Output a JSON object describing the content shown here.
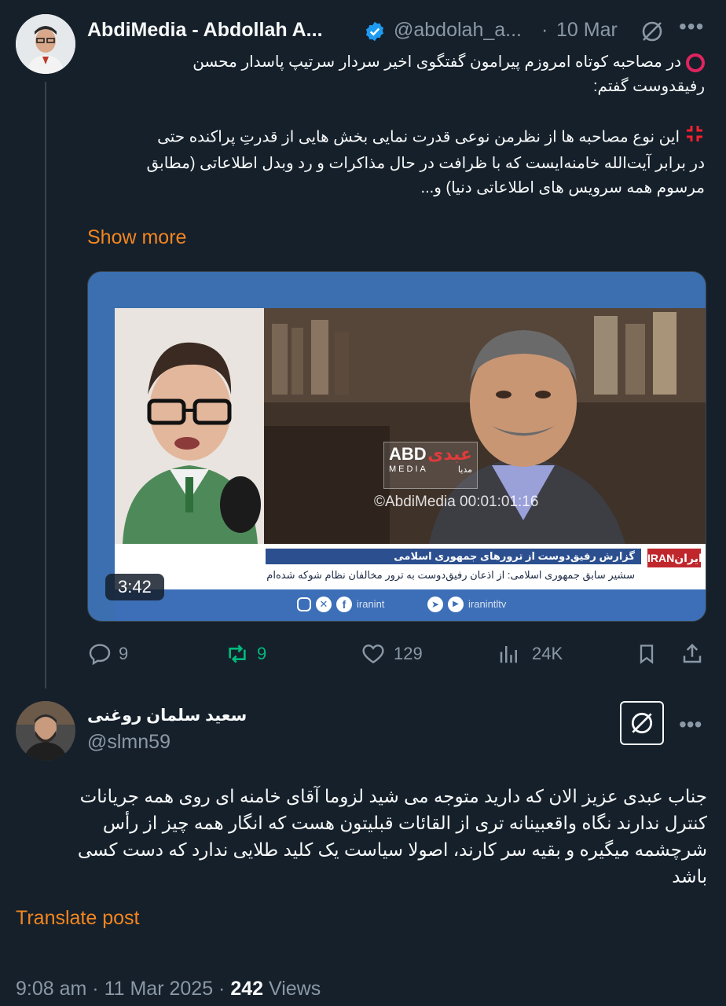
{
  "tweet": {
    "author_name": "AbdiMedia - Abdollah A...",
    "handle": "@abdolah_a...",
    "date": "10 Mar",
    "text_line1": "در مصاحبه کوتاه امروزم پیرامون گفتگوی اخیر سردار سرتیپ پاسدار محسن",
    "text_line2": "رفیقدوست گفتم:",
    "text_line3": "این نوع مصاحبه ها از نظرمن نوعی قدرت نمایی بخش هایی از قدرتِ پراکنده حتی",
    "text_line4": "در برابر آیت‌الله خامنه‌ایست که با ظرافت در حال مذاکرات و رد وبدل اطلاعاتی (مطابق",
    "text_line5": "مرسوم همه سرویس های اطلاعاتی دنیا) و...",
    "show_more": "Show more",
    "media": {
      "duration": "3:42",
      "watermark": "©AbdiMedia 00:01:01:16",
      "logo_top": "ABD",
      "logo_top_fa": "عبدی",
      "logo_bottom": "MEDIA",
      "logo_bottom_fa": "مدیا",
      "banner_line1": "گزارش رفیق‌دوست از ترورهای جمهوری اسلامی",
      "banner_line2": "سشیر سابق جمهوری اسلامی: از اذعان رفیق‌دوست به ترور مخالفان نظام شوکه شده‌ام",
      "channel": "IRANایران",
      "social1": "iranint",
      "social2": "iranintltv"
    },
    "replies": "9",
    "reposts": "9",
    "likes": "129",
    "views": "24K"
  },
  "reply": {
    "author_name": "سعید سلمان روغنی",
    "handle": "@slmn59",
    "text_line1": "جناب عبدی عزیز الان که دارید متوجه می شید لزوما آقای خامنه ای روی همه جریانات",
    "text_line2": "کنترل ندارند نگاه واقعبینانه تری از القائات قبلیتون هست که انگار همه چیز از رأس",
    "text_line3": "شرچشمه میگیره و بقیه سر کارند، اصولا سیاست یک کلید طلایی ندارد که دست کسی",
    "text_line4": "باشد",
    "translate": "Translate post",
    "time": "9:08 am",
    "date": "11 Mar 2025",
    "views_count": "242",
    "views_label": "Views"
  },
  "colors": {
    "background": "#15202b",
    "accent_orange": "#f4861f",
    "repost_green": "#00ba7c",
    "verified_blue": "#1d9bf0",
    "muted": "#8b98a5"
  }
}
